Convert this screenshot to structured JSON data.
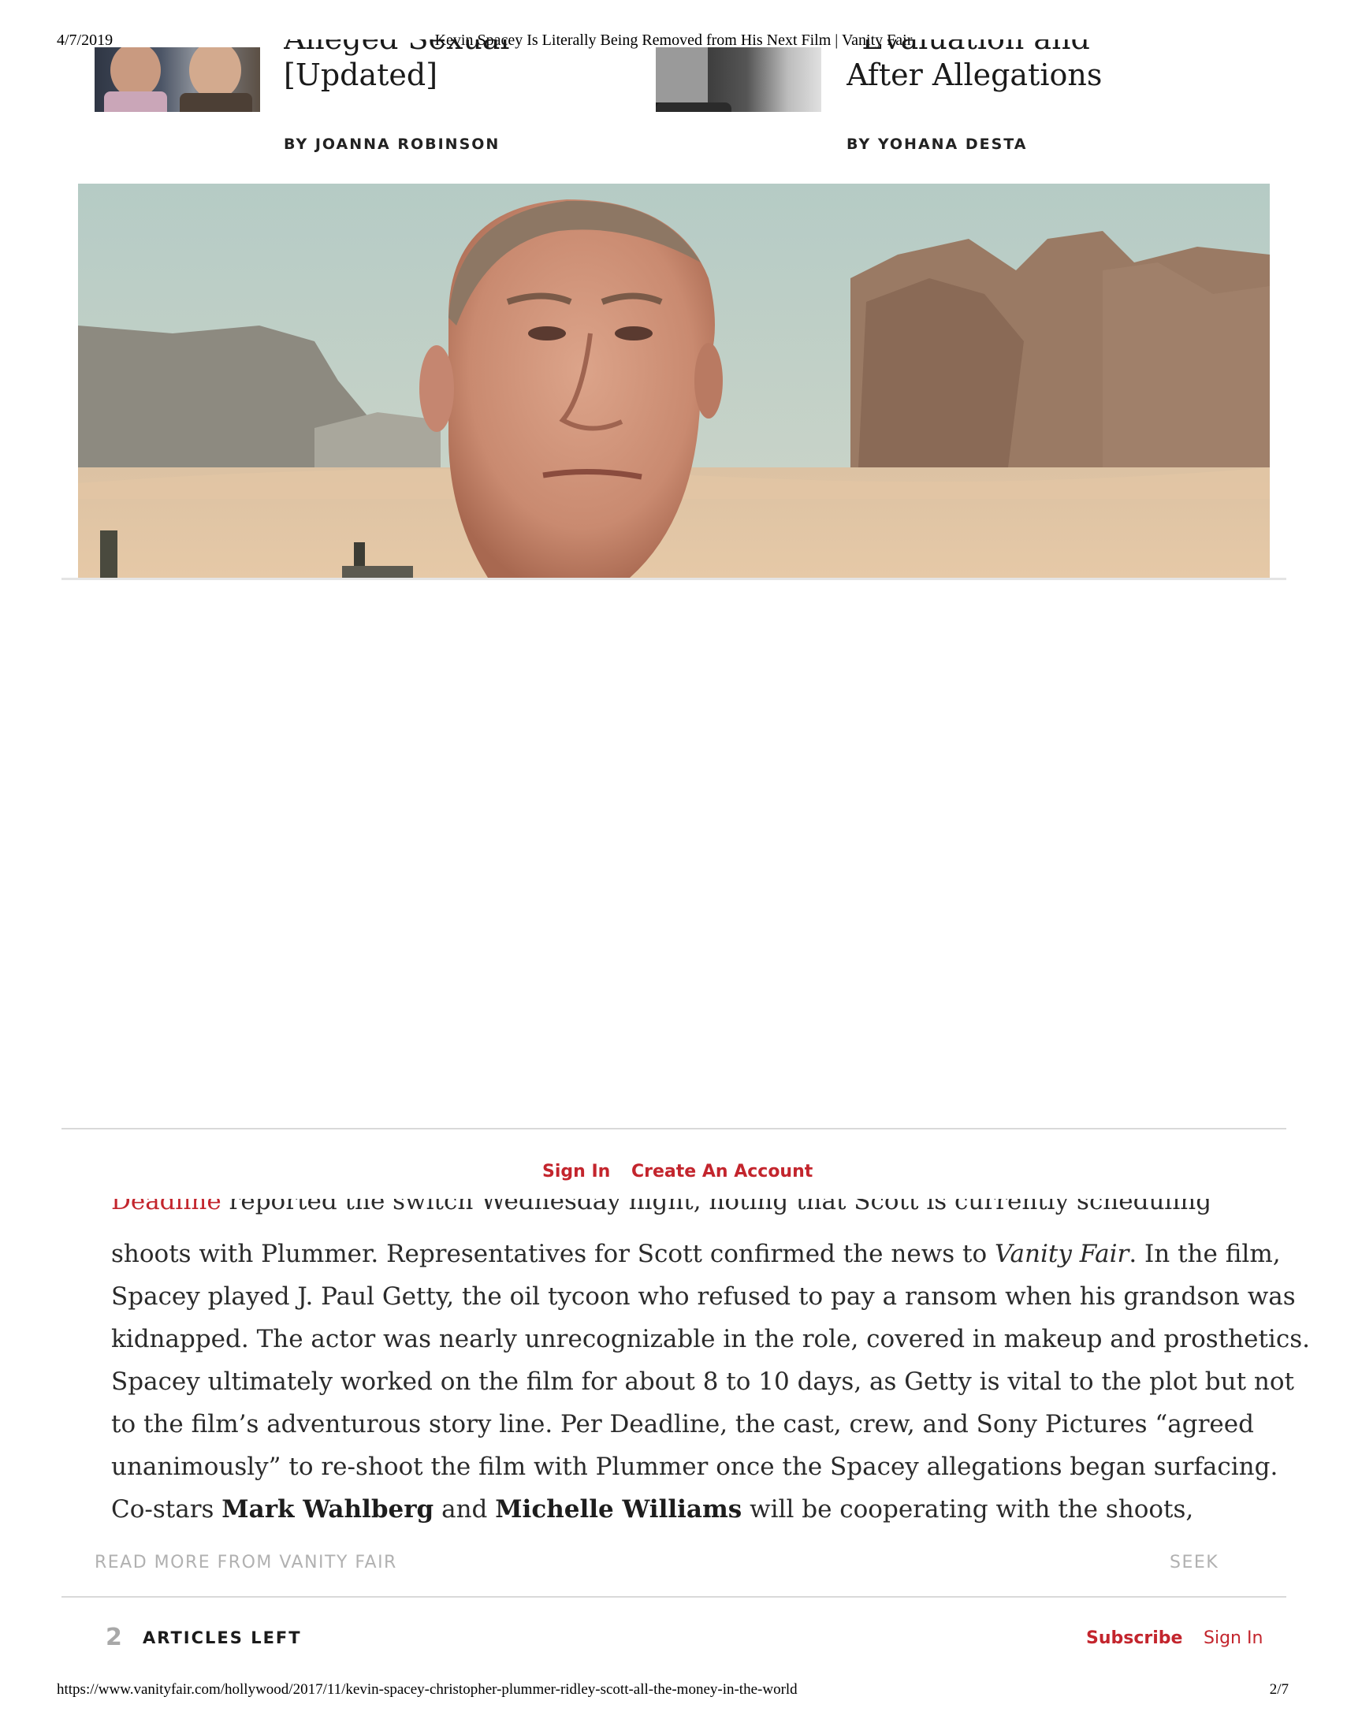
{
  "print_header": {
    "date": "4/7/2019",
    "title": "Kevin Spacey Is Literally Being Removed from His Next Film | Vanity Fair"
  },
  "print_footer": {
    "url": "https://www.vanityfair.com/hollywood/2017/11/kevin-spacey-christopher-plummer-ridley-scott-all-the-money-in-the-world",
    "page": "2/7"
  },
  "related": [
    {
      "title_cut": "Alleged Sexual Misconduct",
      "title_line": "[Updated]",
      "byline": "BY JOANNA ROBINSON"
    },
    {
      "title_cut": "“Evaluation and Treatment”",
      "title_line": "After Allegations",
      "byline": "BY YOHANA DESTA"
    }
  ],
  "auth": {
    "sign_in": "Sign In",
    "create_account": "Create An Account"
  },
  "article": {
    "cut_link": "Deadline",
    "cut_text": " reported the switch Wednesday night, noting that Scott is currently scheduling re-",
    "l1a": "shoots with Plummer. Representatives for Scott confirmed the news to ",
    "l1i": "Vanity Fair",
    "l1b": ". In the film,",
    "l2": "Spacey played J. Paul Getty, the oil tycoon who refused to pay a ransom when his grandson was",
    "l3": "kidnapped. The actor was nearly unrecognizable in the role, covered in makeup and prosthetics.",
    "l4": "Spacey ultimately worked on the film for about 8 to 10 days, as Getty is vital to the plot but not",
    "l5": "to the film’s adventurous story line. Per Deadline, the cast, crew, and Sony Pictures “agreed",
    "l6": "unanimously” to re-shoot the film with Plummer once the Spacey allegations began surfacing.",
    "l7a": "Co-stars ",
    "l7b1": "Mark Wahlberg",
    "l7c": " and ",
    "l7b2": "Michelle Williams",
    "l7d": " will be cooperating with the shoots,"
  },
  "read_more": {
    "label": "READ MORE FROM VANITY FAIR",
    "seek": "SEEK"
  },
  "meter": {
    "count": "2",
    "label": "ARTICLES LEFT",
    "subscribe": "Subscribe",
    "sign_in": "Sign In"
  }
}
